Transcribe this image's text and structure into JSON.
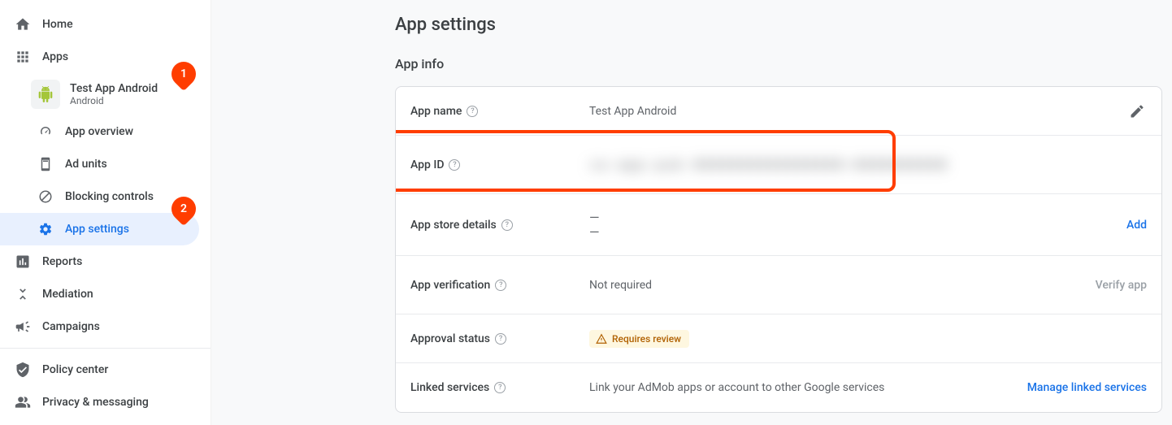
{
  "sidebar": {
    "home": "Home",
    "apps": "Apps",
    "app": {
      "name": "Test App Android",
      "platform": "Android"
    },
    "overview": "App overview",
    "ad_units": "Ad units",
    "blocking": "Blocking controls",
    "settings": "App settings",
    "reports": "Reports",
    "mediation": "Mediation",
    "campaigns": "Campaigns",
    "policy": "Policy center",
    "privacy": "Privacy & messaging"
  },
  "callouts": {
    "one": "1",
    "two": "2"
  },
  "page": {
    "title": "App settings",
    "section": "App info"
  },
  "rows": {
    "app_name": {
      "label": "App name",
      "value": "Test App Android"
    },
    "app_id": {
      "label": "App ID",
      "value": "ca-app-pub-0000000000000000~0000000000"
    },
    "store": {
      "label": "App store details",
      "value1": "—",
      "value2": "—",
      "action": "Add"
    },
    "verification": {
      "label": "App verification",
      "value": "Not required",
      "action": "Verify app"
    },
    "approval": {
      "label": "Approval status",
      "badge": "Requires review"
    },
    "linked": {
      "label": "Linked services",
      "value": "Link your AdMob apps or account to other Google services",
      "action": "Manage linked services"
    }
  }
}
